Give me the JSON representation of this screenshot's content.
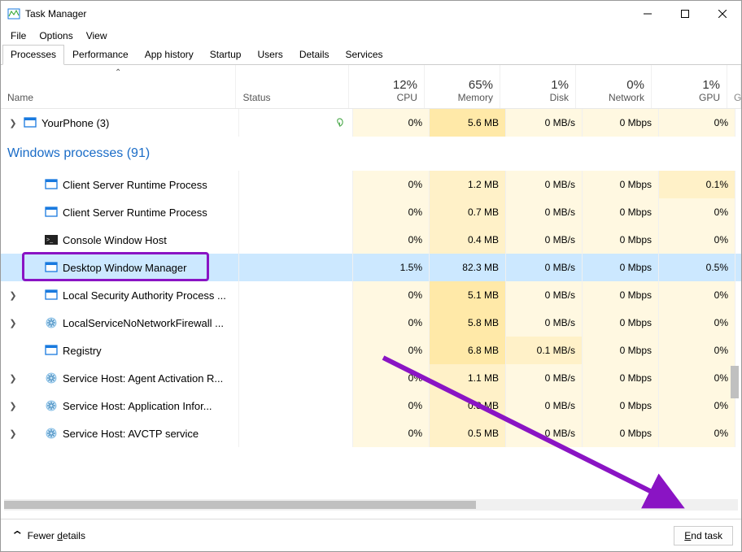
{
  "window": {
    "title": "Task Manager"
  },
  "menu": {
    "file": "File",
    "options": "Options",
    "view": "View"
  },
  "tabs": {
    "processes": "Processes",
    "performance": "Performance",
    "apphistory": "App history",
    "startup": "Startup",
    "users": "Users",
    "details": "Details",
    "services": "Services"
  },
  "headers": {
    "name": "Name",
    "status": "Status",
    "cpu": {
      "pct": "12%",
      "label": "CPU"
    },
    "memory": {
      "pct": "65%",
      "label": "Memory"
    },
    "disk": {
      "pct": "1%",
      "label": "Disk"
    },
    "network": {
      "pct": "0%",
      "label": "Network"
    },
    "gpu": {
      "pct": "1%",
      "label": "GPU"
    }
  },
  "top_row": {
    "name": "YourPhone (3)",
    "cpu": "0%",
    "mem": "5.6 MB",
    "disk": "0 MB/s",
    "net": "0 Mbps",
    "gpu": "0%"
  },
  "group": {
    "label": "Windows processes (91)"
  },
  "rows": [
    {
      "name": "Client Server Runtime Process",
      "cpu": "0%",
      "mem": "1.2 MB",
      "disk": "0 MB/s",
      "net": "0 Mbps",
      "gpu": "0.1%",
      "icon": "app",
      "expand": false
    },
    {
      "name": "Client Server Runtime Process",
      "cpu": "0%",
      "mem": "0.7 MB",
      "disk": "0 MB/s",
      "net": "0 Mbps",
      "gpu": "0%",
      "icon": "app",
      "expand": false
    },
    {
      "name": "Console Window Host",
      "cpu": "0%",
      "mem": "0.4 MB",
      "disk": "0 MB/s",
      "net": "0 Mbps",
      "gpu": "0%",
      "icon": "console",
      "expand": false
    },
    {
      "name": "Desktop Window Manager",
      "cpu": "1.5%",
      "mem": "82.3 MB",
      "disk": "0 MB/s",
      "net": "0 Mbps",
      "gpu": "0.5%",
      "icon": "app",
      "expand": false,
      "selected": true
    },
    {
      "name": "Local Security Authority Process ...",
      "cpu": "0%",
      "mem": "5.1 MB",
      "disk": "0 MB/s",
      "net": "0 Mbps",
      "gpu": "0%",
      "icon": "app",
      "expand": true
    },
    {
      "name": "LocalServiceNoNetworkFirewall ...",
      "cpu": "0%",
      "mem": "5.8 MB",
      "disk": "0 MB/s",
      "net": "0 Mbps",
      "gpu": "0%",
      "icon": "gear",
      "expand": true
    },
    {
      "name": "Registry",
      "cpu": "0%",
      "mem": "6.8 MB",
      "disk": "0.1 MB/s",
      "net": "0 Mbps",
      "gpu": "0%",
      "icon": "app",
      "expand": false
    },
    {
      "name": "Service Host: Agent Activation R...",
      "cpu": "0%",
      "mem": "1.1 MB",
      "disk": "0 MB/s",
      "net": "0 Mbps",
      "gpu": "0%",
      "icon": "gear",
      "expand": true
    },
    {
      "name": "Service Host: Application Infor...",
      "cpu": "0%",
      "mem": "0.8 MB",
      "disk": "0 MB/s",
      "net": "0 Mbps",
      "gpu": "0%",
      "icon": "gear",
      "expand": true
    },
    {
      "name": "Service Host: AVCTP service",
      "cpu": "0%",
      "mem": "0.5 MB",
      "disk": "0 MB/s",
      "net": "0 Mbps",
      "gpu": "0%",
      "icon": "gear",
      "expand": true
    }
  ],
  "footer": {
    "fewer": "Fewer details",
    "endtask": "End task"
  }
}
